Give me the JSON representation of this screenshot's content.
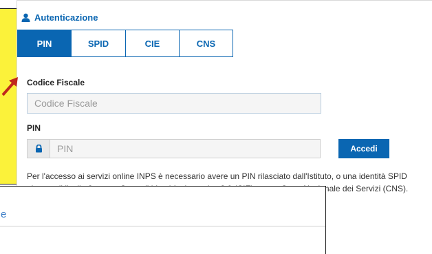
{
  "auth": {
    "title": "Autenticazione",
    "tabs": [
      {
        "label": "PIN",
        "active": true
      },
      {
        "label": "SPID",
        "active": false
      },
      {
        "label": "CIE",
        "active": false
      },
      {
        "label": "CNS",
        "active": false
      }
    ]
  },
  "form": {
    "codice_fiscale_label": "Codice Fiscale",
    "codice_fiscale_placeholder": "Codice Fiscale",
    "pin_label": "PIN",
    "pin_placeholder": "PIN",
    "submit_label": "Accedi"
  },
  "info_text": "Per l'accesso ai servizi online INPS è necessario avere un PIN rilasciato dall'Istituto, o una identità SPID almeno di livello 2, o una Carta di identità elettronica 3.0 (CIE), o una Carta Nazionale dei Servizi (CNS).",
  "overlay": {
    "partial_text": "e"
  },
  "colors": {
    "brand_blue": "#0a66b2",
    "highlight_yellow": "#fbf23a",
    "arrow_red": "#c0281b"
  },
  "icons": {
    "header": "user-icon",
    "pin_addon": "lock-icon",
    "pointer": "red-arrow-icon"
  }
}
